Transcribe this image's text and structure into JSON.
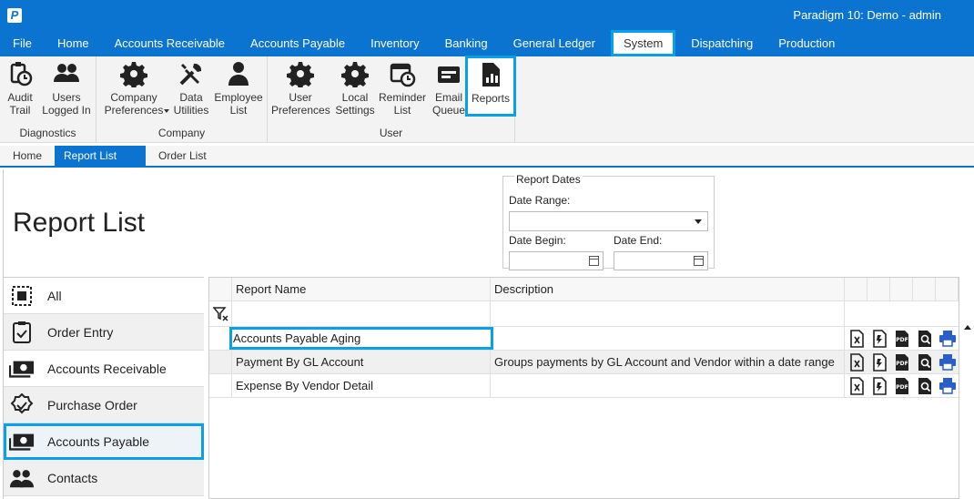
{
  "app": {
    "logo": "P",
    "title": "Paradigm 10: Demo - admin"
  },
  "menu": [
    "File",
    "Home",
    "Accounts Receivable",
    "Accounts Payable",
    "Inventory",
    "Banking",
    "General Ledger",
    "System",
    "Dispatching",
    "Production"
  ],
  "ribbon": {
    "diagnostics": {
      "label": "Diagnostics",
      "audit": "Audit\nTrail",
      "users": "Users\nLogged In"
    },
    "company": {
      "label": "Company",
      "prefs": "Company\nPreferences",
      "data": "Data\nUtilities",
      "employee": "Employee\nList"
    },
    "user": {
      "label": "User",
      "prefs": "User\nPreferences",
      "local": "Local\nSettings",
      "reminder": "Reminder\nList",
      "email": "Email\nQueue",
      "reports": "Reports"
    }
  },
  "doctabs": {
    "home": "Home",
    "report_list": "Report List",
    "close": "✕",
    "order_list": "Order List"
  },
  "page": {
    "title": "Report List",
    "report_dates": {
      "legend": "Report Dates",
      "range_label": "Date Range:",
      "range_value": "",
      "begin_label": "Date Begin:",
      "end_label": "Date End:"
    }
  },
  "categories": [
    "All",
    "Order Entry",
    "Accounts Receivable",
    "Purchase Order",
    "Accounts Payable",
    "Contacts"
  ],
  "grid": {
    "headers": {
      "name": "Report Name",
      "description": "Description"
    },
    "rows": [
      {
        "name": "Accounts Payable Aging",
        "description": ""
      },
      {
        "name": "Payment By GL Account",
        "description": "Groups payments by GL Account and Vendor within a date range"
      },
      {
        "name": "Expense By Vendor Detail",
        "description": ""
      }
    ]
  },
  "colors": {
    "accent": "#0a74d0",
    "highlight": "#0aa0e6"
  }
}
